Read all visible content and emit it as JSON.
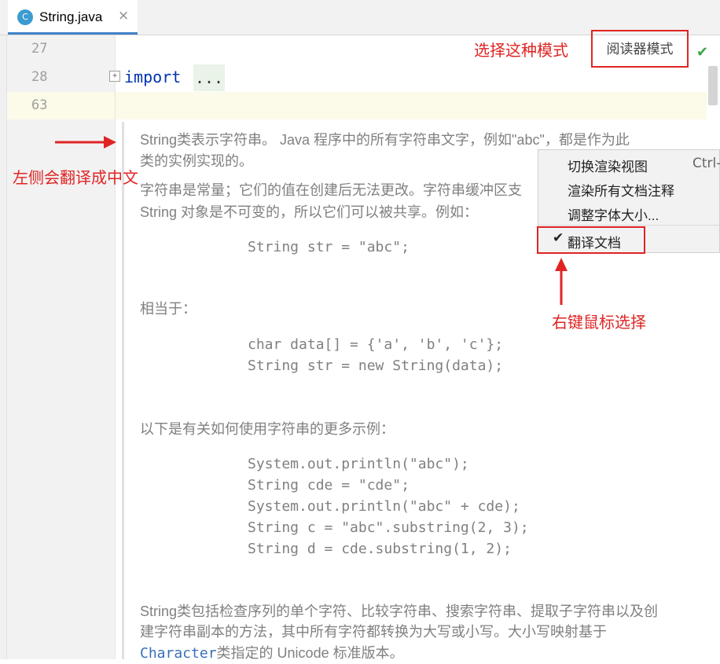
{
  "tab": {
    "icon_letter": "C",
    "label": "String.java",
    "close": "×"
  },
  "gutter": {
    "lines": [
      "27",
      "28",
      "63"
    ]
  },
  "code": {
    "keyword": "import",
    "folded": "..."
  },
  "toolbar": {
    "reader_mode": "阅读器模式",
    "check": "✔"
  },
  "doc": {
    "p1_a": "String类表示字符串。 Java 程序中的所有字符串文字，例如\"abc\"，都是作为此",
    "p1_b": "类的实例实现的。",
    "p2_a": "字符串是常量；它们的值在创建后无法更改。字符串缓冲区支",
    "p2_b": "String 对象是不可变的，所以它们可以被共享。例如：",
    "code1": "String str = \"abc\";",
    "equiv": "相当于：",
    "code2": [
      "char data[] = {'a', 'b', 'c'};",
      "String str = new String(data);"
    ],
    "more": "以下是有关如何使用字符串的更多示例：",
    "code3": [
      "System.out.println(\"abc\");",
      "String cde = \"cde\";",
      "System.out.println(\"abc\" + cde);",
      "String c = \"abc\".substring(2, 3);",
      "String d = cde.substring(1, 2);"
    ],
    "p4_a": "String类包括检查序列的单个字符、比较字符串、搜索字符串、提取子字符串以及创",
    "p4_b": "建字符串副本的方法，其中所有字符都转换为大写或小写。大小写映射基于",
    "p4_c_link": "Character",
    "p4_c_rest": "类指定的 Unicode 标准版本。"
  },
  "context_menu": {
    "items": [
      "切换渲染视图",
      "渲染所有文档注释",
      "调整字体大小..."
    ],
    "shortcut": "Ctrl-",
    "selected": "翻译文档",
    "check": "✔"
  },
  "annotations": {
    "choose_mode": "选择这种模式",
    "left_translate": "左侧会翻译成中文",
    "right_click": "右键鼠标选择"
  },
  "colors": {
    "accent_red": "#e02424",
    "tab_underline": "#4083c9"
  }
}
